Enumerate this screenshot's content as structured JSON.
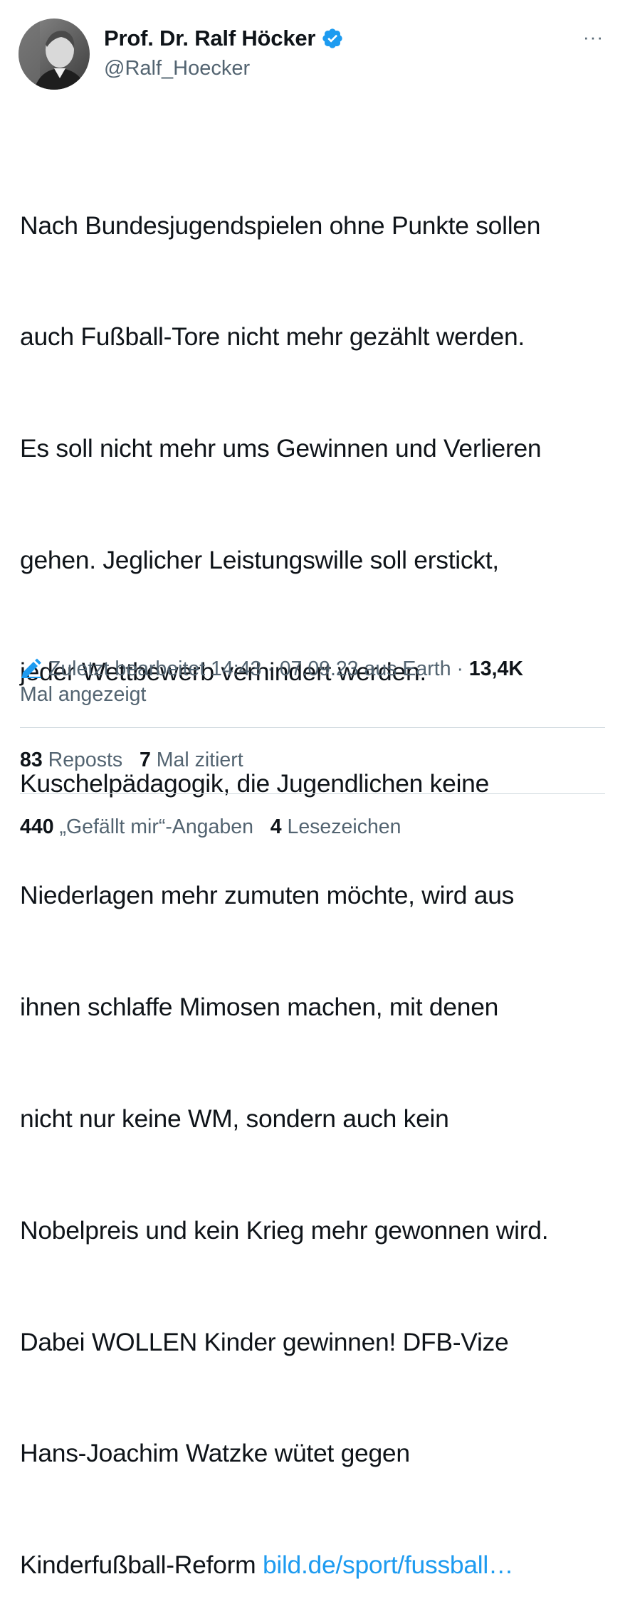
{
  "author": {
    "display_name": "Prof. Dr. Ralf Höcker",
    "handle": "@Ralf_Hoecker",
    "verified": true
  },
  "header": {
    "more_label": "···"
  },
  "tweet": {
    "lines": [
      "Nach Bundesjugendspielen ohne Punkte sollen",
      "auch Fußball-Tore nicht mehr gezählt werden.",
      "Es soll nicht mehr ums Gewinnen und Verlieren",
      "gehen. Jeglicher Leistungswille soll erstickt,",
      "jeder Wettbewerb verhindert werden.",
      "Kuschelpädagogik, die Jugendlichen keine",
      "Niederlagen mehr zumuten möchte, wird aus",
      "ihnen schlaffe Mimosen machen, mit denen",
      "nicht nur keine WM, sondern auch kein",
      "Nobelpreis und kein Krieg mehr gewonnen wird.",
      "Dabei WOLLEN Kinder gewinnen! DFB-Vize",
      "Hans-Joachim Watzke wütet gegen"
    ],
    "last_line_text": "Kinderfußball-Reform ",
    "link_text": "bild.de/sport/fussball…"
  },
  "meta": {
    "edited_label": "Zuletzt bearbeitet 14:43 · 07.09.23  aus Earth ·",
    "views_count": "13,4K",
    "views_label": "Mal angezeigt"
  },
  "stats": {
    "reposts_count": "83",
    "reposts_label": "Reposts",
    "quotes_count": "7",
    "quotes_label": "Mal zitiert",
    "likes_count": "440",
    "likes_label": "„Gefällt mir“-Angaben",
    "bookmarks_count": "4",
    "bookmarks_label": "Lesezeichen"
  },
  "colors": {
    "link": "#1d9bf0",
    "secondary_text": "#536471",
    "primary_text": "#0f1419",
    "verified_badge": "#1d9bf0",
    "divider": "#cfd9de"
  },
  "icons": {
    "verified": "verified-badge-icon",
    "edit": "pencil-icon",
    "more": "more-dots-icon"
  }
}
